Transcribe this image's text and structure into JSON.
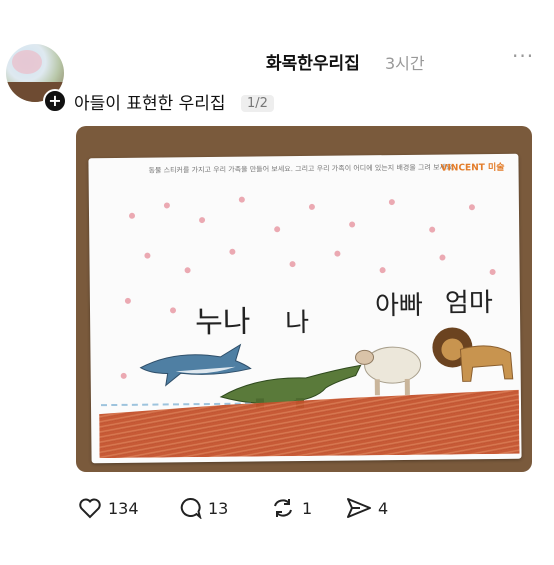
{
  "post": {
    "username": "화목한우리집",
    "time": "3시간",
    "more": "···",
    "caption": "아들이 표현한 우리집",
    "image_counter": "1/2"
  },
  "drawing": {
    "header_text": "동물 스티커를 가지고 우리 가족을 만들어 보세요. 그리고 우리 가족이 어디에 있는지 배경을 그려 보세요.",
    "brand": "VINCENT 미술",
    "label_sister": "누나",
    "label_me": "나",
    "label_dad": "아빠",
    "label_mom": "엄마"
  },
  "actions": {
    "likes": "134",
    "comments": "13",
    "reposts": "1",
    "shares": "4"
  },
  "icons": [
    "heart-icon",
    "comment-icon",
    "repost-icon",
    "share-icon",
    "more-icon",
    "follow-plus-icon"
  ]
}
